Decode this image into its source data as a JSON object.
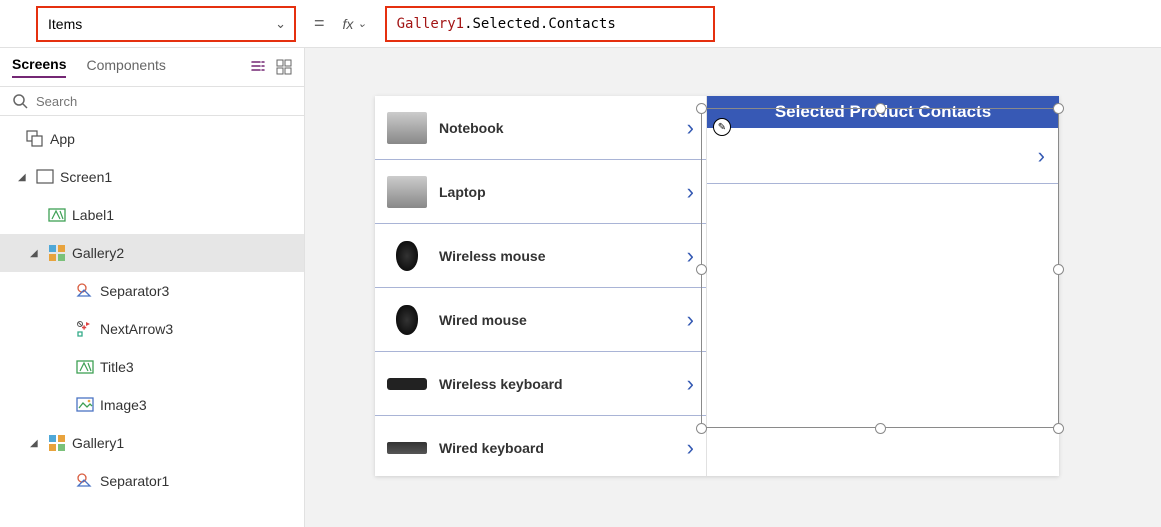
{
  "topbar": {
    "property": "Items",
    "equals": "=",
    "fx": "fx",
    "formula_highlighted": "Gallery1",
    "formula_rest": ".Selected.Contacts"
  },
  "leftPanel": {
    "tabs": {
      "screens": "Screens",
      "components": "Components"
    },
    "search_placeholder": "Search",
    "tree": {
      "app": "App",
      "screen1": "Screen1",
      "label1": "Label1",
      "gallery2": "Gallery2",
      "separator3": "Separator3",
      "nextarrow3": "NextArrow3",
      "title3": "Title3",
      "image3": "Image3",
      "gallery1": "Gallery1",
      "separator1": "Separator1"
    }
  },
  "canvas": {
    "products": [
      "Notebook",
      "Laptop",
      "Wireless mouse",
      "Wired mouse",
      "Wireless keyboard",
      "Wired keyboard"
    ],
    "rightHeader": "Selected Product Contacts"
  }
}
